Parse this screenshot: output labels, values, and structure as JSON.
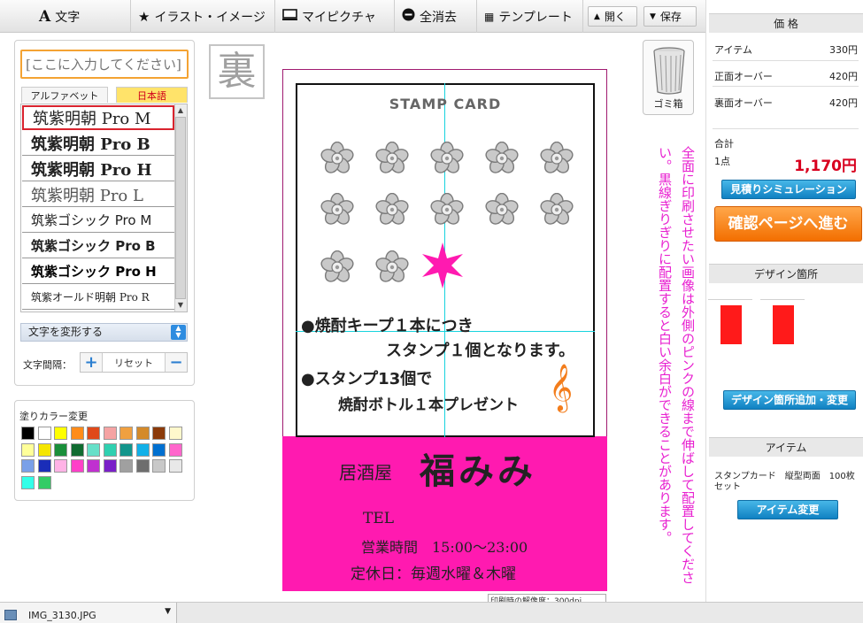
{
  "toolbar": {
    "text_label": "文字",
    "illust_label": "イラスト・イメージ",
    "mypic_label": "マイピクチャ",
    "clear_label": "全消去",
    "template_label": "テンプレート",
    "open_label": "開く",
    "save_label": "保存"
  },
  "text_panel": {
    "input_placeholder": "[ここに入力してください]",
    "tab_alpha": "アルファベット",
    "tab_japanese": "日本語",
    "fonts": [
      "筑紫明朝 Pro M",
      "筑紫明朝 Pro B",
      "筑紫明朝 Pro H",
      "筑紫明朝 Pro L",
      "筑紫ゴシック Pro M",
      "筑紫ゴシック Pro B",
      "筑紫ゴシック Pro H",
      "筑紫オールド明朝 Pro R"
    ],
    "transform_label": "文字を変形する",
    "spacing_label": "文字間隔：",
    "spacing_plus": "+",
    "spacing_reset": "リセット",
    "spacing_minus": "−"
  },
  "color_panel": {
    "title": "塗りカラー変更",
    "swatches": [
      "#000000",
      "#ffffff",
      "#ffff00",
      "#ff8c1a",
      "#e0491a",
      "#f5a3a3",
      "#f0a040",
      "#d48a2a",
      "#8b3a0a",
      "#fff8cc",
      "#ffff99",
      "#f5e600",
      "#1a8f3a",
      "#106b30",
      "#66e0c8",
      "#30d0b0",
      "#13958c",
      "#12b0e8",
      "#0070d0",
      "#ff66cc",
      "#7aa0e8",
      "#1a2db8",
      "#ffb3e6",
      "#ff40c8",
      "#c030d0",
      "#7a20c8",
      "#a0a0a0",
      "#6e6e6e",
      "#c8c8c8",
      "#e8e8e8",
      "#33ffe8",
      "#33cc66"
    ]
  },
  "canvas": {
    "side_badge": "裏",
    "trash_label": "ゴミ箱",
    "card": {
      "title": "STAMP CARD",
      "line1": "●焼酎キープ１本につき",
      "line2": "スタンプ１個となります。",
      "line3": "●スタンプ13個で",
      "line4": "焼酎ボトル１本プレゼント",
      "shop_prefix": "居酒屋",
      "shop_name": "福みみ",
      "tel": "TEL",
      "hours": "営業時間　15:00～23:00",
      "holiday": "定休日：毎週水曜＆木曜"
    },
    "note": "全面に印刷させたい画像は外側のピンクの線まで伸ばして配置してください。黒線ぎりぎりに配置すると白い余白ができることがあります。",
    "resolution_text": "印刷時の解像度：300dpi"
  },
  "price": {
    "heading": "価 格",
    "rows": [
      {
        "label": "アイテム",
        "value": "330円"
      },
      {
        "label": "正面オーバー",
        "value": "420円"
      },
      {
        "label": "裏面オーバー",
        "value": "420円"
      }
    ],
    "total_label": "合計",
    "qty": "1点",
    "total": "1,170円",
    "estimate_btn": "見積りシミュレーション",
    "confirm_btn": "確認ページへ進む"
  },
  "design_area": {
    "heading": "デザイン箇所",
    "add_btn": "デザイン箇所追加・変更"
  },
  "item": {
    "heading": "アイテム",
    "desc": "スタンプカード　縦型両面　100枚セット",
    "change_btn": "アイテム変更"
  },
  "bottom": {
    "file_name": "IMG_3130.JPG"
  }
}
